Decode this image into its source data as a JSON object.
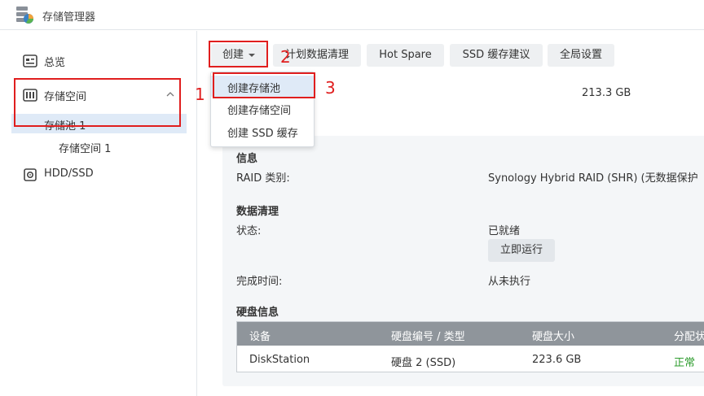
{
  "app": {
    "title": "存储管理器",
    "icon": "storage-manager-icon"
  },
  "sidebar": {
    "items": [
      {
        "label": "总览",
        "icon": "overview-icon"
      },
      {
        "label": "存储空间",
        "icon": "storage-icon",
        "expanded": true
      },
      {
        "label": "HDD/SSD",
        "icon": "disk-icon"
      }
    ],
    "sub_items": [
      {
        "label": "存储池 1",
        "selected": true
      },
      {
        "label": "存储空间 1"
      }
    ]
  },
  "toolbar": {
    "create": "创建",
    "scrub_schedule": "计划数据清理",
    "hot_spare": "Hot Spare",
    "ssd_cache_advice": "SSD 缓存建议",
    "global_settings": "全局设置"
  },
  "dropdown": {
    "items": [
      {
        "label": "创建存储池",
        "active": true
      },
      {
        "label": "创建存储空间"
      },
      {
        "label": "创建 SSD 缓存"
      }
    ]
  },
  "annotations": {
    "a1": "1",
    "a2": "2",
    "a3": "3",
    "color": "#e01e1e"
  },
  "pool": {
    "size": "213.3 GB"
  },
  "info": {
    "heading": "信息",
    "raid_label": "RAID 类别:",
    "raid_value": "Synology Hybrid RAID (SHR) (无数据保护"
  },
  "scrubbing": {
    "heading": "数据清理",
    "status_label": "状态:",
    "status_value": "已就绪",
    "run_now": "立即运行",
    "finish_label": "完成时间:",
    "finish_value": "从未执行"
  },
  "disk_info": {
    "heading": "硬盘信息",
    "columns": [
      "设备",
      "硬盘编号 / 类型",
      "硬盘大小",
      "分配状"
    ],
    "rows": [
      {
        "device": "DiskStation",
        "disk": "硬盘 2 (SSD)",
        "size": "223.6 GB",
        "status": "正常"
      }
    ]
  },
  "colors": {
    "accent": "#dfeaf7",
    "ok": "#2e9c2e",
    "table_header": "#8f959b"
  }
}
